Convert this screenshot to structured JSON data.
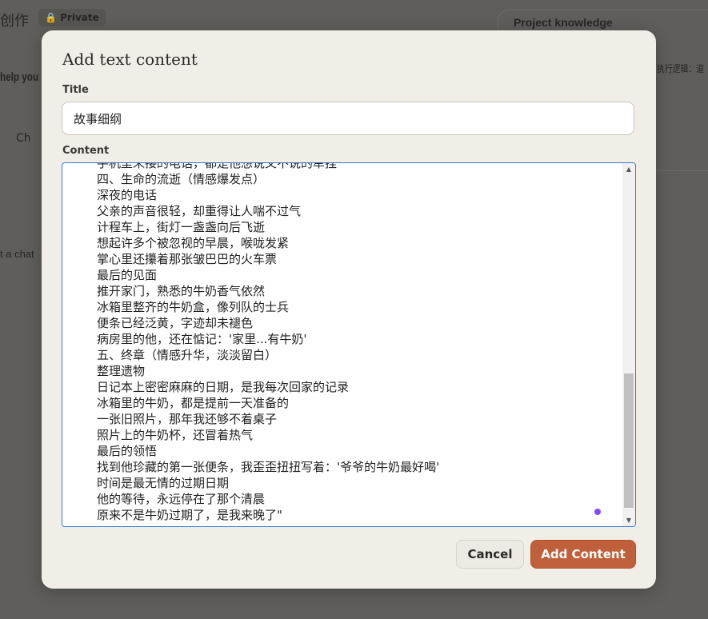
{
  "background": {
    "project_title": "创作",
    "privacy_badge": "Private",
    "project_knowledge": "Project knowledge",
    "instruction_snippet": "执行逻辑：道",
    "help_snippet": "help you",
    "chat_snippet": "Ch",
    "start_chat_snippet": "t a chat"
  },
  "modal": {
    "heading": "Add text content",
    "title_label": "Title",
    "title_value": "故事细纲",
    "content_label": "Content",
    "content_lines": [
      "手机里未接的电话，都是他想说又不说的牵挂",
      "四、生命的流逝（情感爆发点）",
      "深夜的电话",
      "父亲的声音很轻，却重得让人喘不过气",
      "计程车上，街灯一盏盏向后飞逝",
      "想起许多个被忽视的早晨，喉咙发紧",
      "掌心里还攥着那张皱巴巴的火车票",
      "最后的见面",
      "推开家门，熟悉的牛奶香气依然",
      "冰箱里整齐的牛奶盒，像列队的士兵",
      "便条已经泛黄，字迹却未褪色",
      "病房里的他，还在惦记：'家里...有牛奶'",
      "五、终章（情感升华，淡淡留白）",
      "整理遗物",
      "日记本上密密麻麻的日期，是我每次回家的记录",
      "冰箱里的牛奶，都是提前一天准备的",
      "一张旧照片，那年我还够不着桌子",
      "照片上的牛奶杯，还冒着热气",
      "最后的领悟",
      "找到他珍藏的第一张便条，我歪歪扭扭写着：'爷爷的牛奶最好喝'",
      "时间是最无情的过期日期",
      "他的等待，永远停在了那个清晨",
      "原来不是牛奶过期了，是我来晚了\""
    ],
    "cancel_label": "Cancel",
    "add_label": "Add Content"
  },
  "colors": {
    "accent": "#c0603a",
    "focus": "#3a7bd5"
  }
}
